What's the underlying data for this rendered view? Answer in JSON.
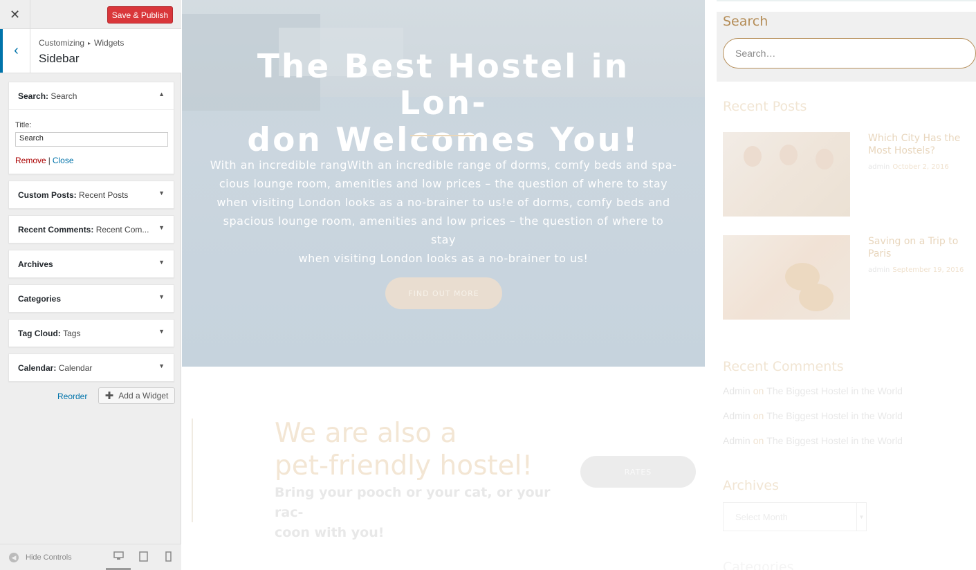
{
  "customizer": {
    "close_icon": "close-icon",
    "save_label": "Save & Publish",
    "breadcrumb": [
      "Customizing",
      "Widgets"
    ],
    "breadcrumb_sep": "▸",
    "section_title": "Sidebar",
    "widgets": [
      {
        "type": "Search:",
        "instance": "Search",
        "expanded": true
      },
      {
        "type": "Custom Posts:",
        "instance": "Recent Posts",
        "expanded": false
      },
      {
        "type": "Recent Comments:",
        "instance": "Recent Com...",
        "expanded": false
      },
      {
        "type": "Archives",
        "instance": "",
        "expanded": false
      },
      {
        "type": "Categories",
        "instance": "",
        "expanded": false
      },
      {
        "type": "Tag Cloud:",
        "instance": "Tags",
        "expanded": false
      },
      {
        "type": "Calendar:",
        "instance": "Calendar",
        "expanded": false
      }
    ],
    "search_widget": {
      "title_label": "Title:",
      "title_value": "Search",
      "remove_label": "Remove",
      "separator": "|",
      "close_label": "Close"
    },
    "reorder_label": "Reorder",
    "add_widget_label": "Add a Widget",
    "hide_controls_label": "Hide Controls",
    "accent_color": "#0073aa",
    "save_color": "#d9363a"
  },
  "preview": {
    "hero": {
      "title": "The Best Hostel in Lon-don Welcomes You!",
      "title_line1": "The Best Hostel in Lon-",
      "title_line2": "don Welcomes You!",
      "text_lines": [
        "With an incredible rangWith an incredible range of dorms, comfy beds and spa-",
        "cious lounge room, amenities and low prices – the question of where to stay",
        "when visiting London looks as a no-brainer to us!e of dorms, comfy beds and",
        "spacious lounge room, amenities and low prices – the question of where to stay",
        "when visiting London looks as a no-brainer to us!"
      ],
      "button_label": "FIND OUT MORE"
    },
    "pet": {
      "title_line1": "We are also a",
      "title_line2": "pet-friendly hostel!",
      "sub_line1": "Bring your pooch or your cat, or your rac-",
      "sub_line2": "coon with you!",
      "button_label": "RATES"
    },
    "sidebar": {
      "search_title": "Search",
      "search_placeholder": "Search…",
      "recent_posts_title": "Recent Posts",
      "posts": [
        {
          "title": "Which City Has the Most Hostels?",
          "author": "admin",
          "date": "October 2, 2016"
        },
        {
          "title": "Saving on a Trip to Paris",
          "author": "admin",
          "date": "September 19, 2016"
        }
      ],
      "recent_comments_title": "Recent Comments",
      "comments": [
        {
          "author": "Admin",
          "on": "on",
          "post": "The Biggest Hostel in the World"
        },
        {
          "author": "Admin",
          "on": "on",
          "post": "The Biggest Hostel in the World"
        },
        {
          "author": "Admin",
          "on": "on",
          "post": "The Biggest Hostel in the World"
        }
      ],
      "archives_title": "Archives",
      "archives_select": "Select Month",
      "categories_title": "Categories"
    },
    "brand_color": "#b48c56"
  }
}
